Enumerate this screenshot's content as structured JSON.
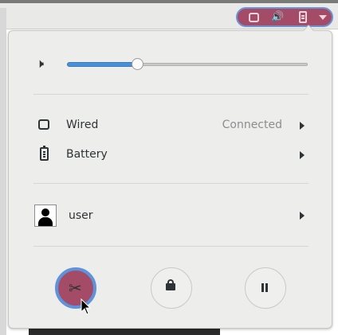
{
  "panel": {
    "tray_icons": [
      "network-wired-icon",
      "audio-volume-icon",
      "battery-icon",
      "dropdown-arrow-icon"
    ],
    "highlight_color": "#a34b67"
  },
  "menu": {
    "volume": {
      "icon": "audio-volume-icon",
      "level": 0.29
    },
    "items": [
      {
        "icon": "network-wired-icon",
        "label": "Wired",
        "status": "Connected"
      },
      {
        "icon": "battery-icon",
        "label": "Battery",
        "status": ""
      }
    ],
    "user": {
      "icon": "avatar-icon",
      "label": "user"
    },
    "actions": [
      {
        "name": "settings",
        "icon": "settings-tools-icon"
      },
      {
        "name": "lock",
        "icon": "lock-icon"
      },
      {
        "name": "suspend",
        "icon": "pause-icon"
      }
    ]
  }
}
